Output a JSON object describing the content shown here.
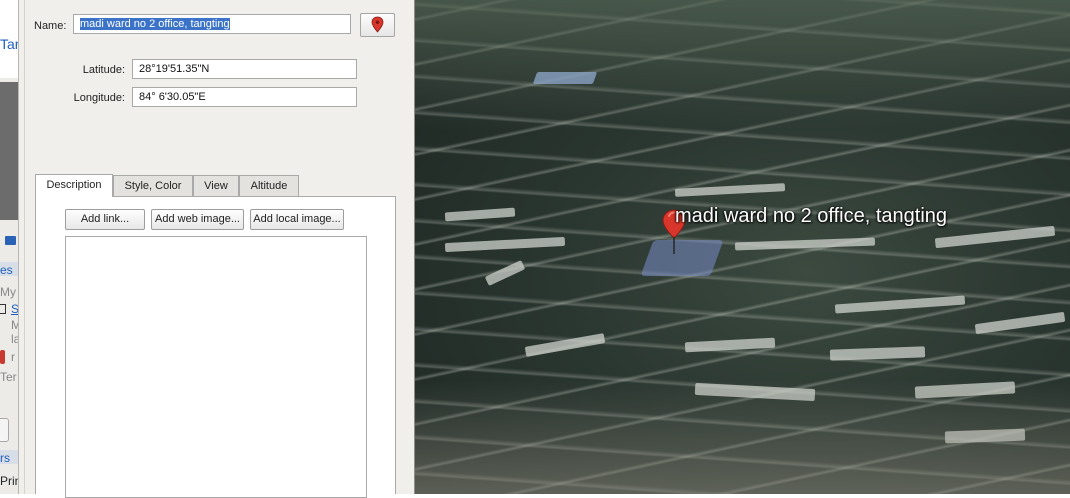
{
  "sidebar": {
    "link_fragment": "Tar",
    "text_fragments": [
      "es",
      "My",
      "S",
      "M",
      "la",
      "r",
      "Ter",
      "rs",
      "Prin"
    ]
  },
  "dialog": {
    "name_label": "Name:",
    "name_value": "madi ward no 2 office, tangting",
    "latitude_label": "Latitude:",
    "latitude_value": "28°19'51.35\"N",
    "longitude_label": "Longitude:",
    "longitude_value": "84° 6'30.05\"E",
    "tabs": [
      {
        "label": "Description",
        "active": true
      },
      {
        "label": "Style, Color",
        "active": false
      },
      {
        "label": "View",
        "active": false
      },
      {
        "label": "Altitude",
        "active": false
      }
    ],
    "buttons": {
      "add_link": "Add link...",
      "add_web_image": "Add web image...",
      "add_local_image": "Add local image..."
    },
    "description_value": ""
  },
  "map": {
    "placemark_label": "madi ward no 2 office, tangting",
    "pin_color": "#d9362b"
  },
  "colors": {
    "selection": "#3b73c9",
    "panel_bg": "#f0efec",
    "link": "#1f5fbf"
  },
  "icons": {
    "placemark_button": "pushpin-icon",
    "print": "print-icon"
  }
}
